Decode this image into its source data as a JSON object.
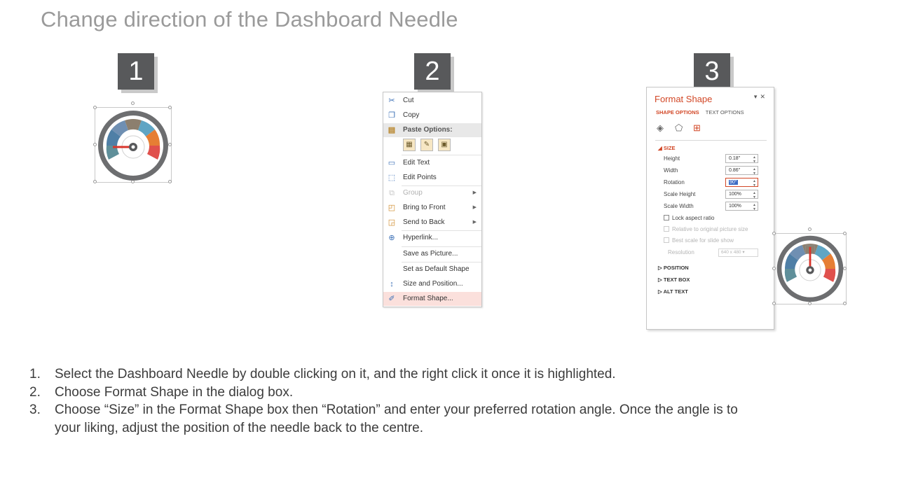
{
  "slide": {
    "title": "Change direction of the Dashboard Needle"
  },
  "steps_badges": [
    "1",
    "2",
    "3"
  ],
  "context_menu": {
    "items": [
      {
        "label": "Cut",
        "icon": "scissors-icon"
      },
      {
        "label": "Copy",
        "icon": "copy-icon"
      },
      {
        "label": "Paste Options:",
        "icon": "paste-icon"
      },
      {
        "label": "Edit Text",
        "icon": "edit-text-icon"
      },
      {
        "label": "Edit Points",
        "icon": "edit-points-icon"
      },
      {
        "label": "Group",
        "icon": "group-icon",
        "disabled": true
      },
      {
        "label": "Bring to Front",
        "icon": "bring-to-front-icon"
      },
      {
        "label": "Send to Back",
        "icon": "send-to-back-icon"
      },
      {
        "label": "Hyperlink...",
        "icon": "hyperlink-icon"
      },
      {
        "label": "Save as Picture...",
        "icon": ""
      },
      {
        "label": "Set as Default Shape",
        "icon": ""
      },
      {
        "label": "Size and Position...",
        "icon": "size-position-icon"
      },
      {
        "label": "Format Shape...",
        "icon": "format-shape-icon"
      }
    ]
  },
  "format_panel": {
    "title": "Format Shape",
    "tabs": [
      "SHAPE OPTIONS",
      "TEXT OPTIONS"
    ],
    "size_section": "SIZE",
    "fields": [
      {
        "label": "Height",
        "value": "0.18\""
      },
      {
        "label": "Width",
        "value": "0.86\""
      },
      {
        "label": "Rotation",
        "value": "90°"
      },
      {
        "label": "Scale Height",
        "value": "100%"
      },
      {
        "label": "Scale Width",
        "value": "100%"
      }
    ],
    "checkboxes": [
      {
        "label": "Lock aspect ratio",
        "disabled": false
      },
      {
        "label": "Relative to original picture size",
        "disabled": true
      },
      {
        "label": "Best scale for slide show",
        "disabled": true
      }
    ],
    "resolution_label": "Resolution",
    "resolution_value": "640 x 480",
    "sections": [
      "POSITION",
      "TEXT BOX",
      "ALT TEXT"
    ]
  },
  "gauge": {
    "segment_colors": [
      "#5f8f9a",
      "#4f7fa6",
      "#6f8fb2",
      "#8c7f6e",
      "#5fa5c4",
      "#e67e34",
      "#e0504c"
    ],
    "ring_color": "#6d6e70",
    "needle_color": "#d9342b"
  },
  "instructions": [
    {
      "num": "1.",
      "text": "Select the Dashboard Needle by double clicking on it, and the right click it once it is highlighted."
    },
    {
      "num": "2.",
      "text": "Choose Format Shape in the dialog box."
    },
    {
      "num": "3.",
      "text": "Choose “Size” in the Format Shape box then “Rotation” and enter your preferred rotation angle. Once the angle is to your liking, adjust the position of the needle back to the centre."
    }
  ]
}
